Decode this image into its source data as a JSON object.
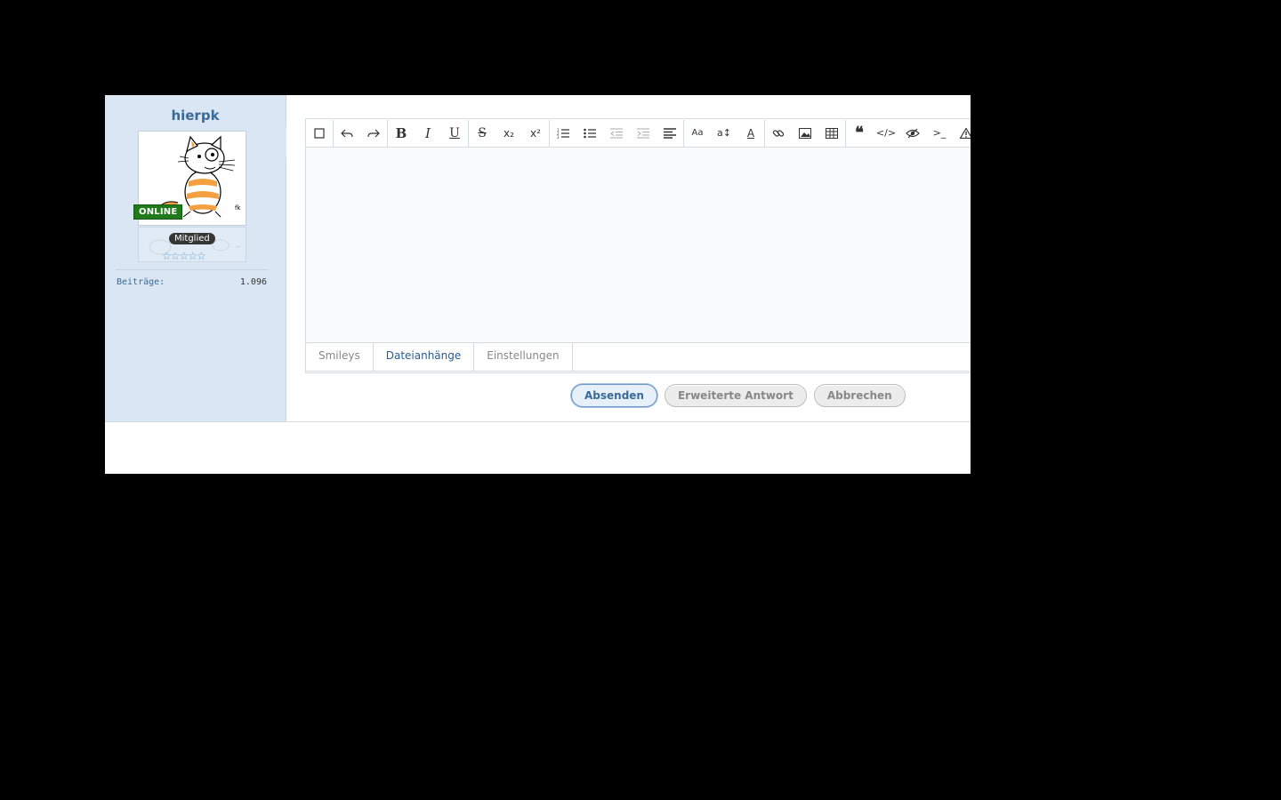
{
  "user": {
    "name": "hierpk",
    "status": "ONLINE",
    "rank": "Mitglied",
    "stars": "☆☆☆☆☆",
    "stat_label": "Beiträge:",
    "stat_value": "1.096"
  },
  "toolbar": {
    "icons": [
      "square-icon",
      "undo-icon",
      "redo-icon",
      "bold-icon",
      "italic-icon",
      "underline-icon",
      "strikethrough-icon",
      "subscript-icon",
      "superscript-icon",
      "ordered-list-icon",
      "unordered-list-icon",
      "outdent-icon",
      "indent-icon",
      "align-icon",
      "font-family-icon",
      "font-size-icon",
      "font-color-icon",
      "link-icon",
      "image-icon",
      "table-icon",
      "quote-icon",
      "code-icon",
      "spoiler-icon",
      "terminal-icon",
      "warning-icon"
    ]
  },
  "tabs": [
    "Smileys",
    "Dateianhänge",
    "Einstellungen"
  ],
  "buttons": {
    "submit": "Absenden",
    "advanced": "Erweiterte Antwort",
    "cancel": "Abbrechen"
  }
}
